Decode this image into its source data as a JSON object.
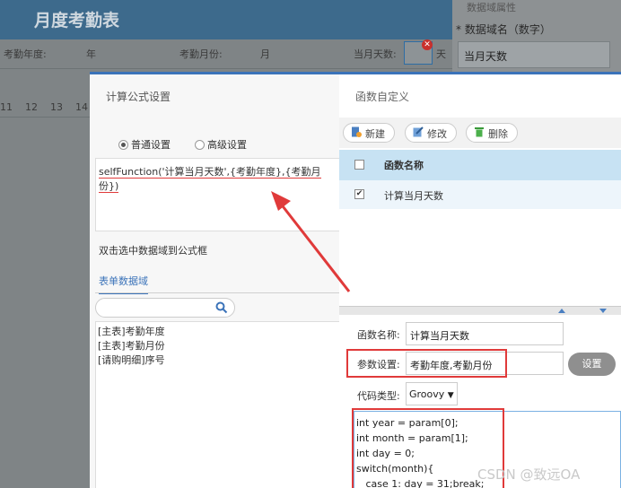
{
  "background": {
    "report_title": "月度考勤表",
    "labels": [
      "考勤年度:",
      "年",
      "考勤月份:",
      "月",
      "当月天数:",
      "天"
    ],
    "day_numbers": [
      "11",
      "12",
      "13",
      "14"
    ],
    "right_panel": {
      "header_fragment": "数据域属性",
      "field_label": "* 数据域名（数字）",
      "field_value": "当月天数"
    }
  },
  "formula_dialog": {
    "title": "计算公式设置",
    "radio_options": [
      {
        "label": "普通设置",
        "selected": true
      },
      {
        "label": "高级设置",
        "selected": false
      }
    ],
    "formula": "selfFunction('计算当月天数',{考勤年度},{考勤月份})",
    "hint": "双击选中数据域到公式框",
    "tab": "表单数据域",
    "search_placeholder": "",
    "fields": [
      "[主表]考勤年度",
      "[主表]考勤月份",
      "[请购明细]序号"
    ]
  },
  "function_dialog": {
    "title": "函数自定义",
    "toolbar": {
      "new_label": "新建",
      "edit_label": "修改",
      "delete_label": "删除"
    },
    "table": {
      "column_header": "函数名称",
      "rows": [
        {
          "name": "计算当月天数",
          "checked": true
        }
      ]
    },
    "form": {
      "name_label": "函数名称:",
      "name_value": "计算当月天数",
      "params_label": "参数设置:",
      "params_value": "考勤年度,考勤月份",
      "set_button": "设置",
      "code_type_label": "代码类型:",
      "code_type_value": "Groovy",
      "code_lines": [
        "int year = param[0];",
        "int month = param[1];",
        "int day = 0;",
        "switch(month){",
        "   case 1: day = 31;break;"
      ]
    }
  },
  "watermark": "CSDN @致远OA",
  "colors": {
    "accent_blue": "#3b73b9",
    "highlight_red": "#e03a3a",
    "table_header": "#c7e2f3"
  }
}
